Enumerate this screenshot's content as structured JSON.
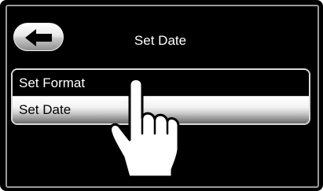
{
  "header": {
    "title": "Set Date",
    "back_icon": "left-arrow-icon"
  },
  "menu": {
    "items": [
      {
        "label": "Set Format",
        "selected": false
      },
      {
        "label": "Set Date",
        "selected": true
      }
    ]
  },
  "overlay": {
    "icon": "tapping-hand-icon"
  },
  "colors": {
    "screen_bg": "#000000",
    "text_light": "#ffffff",
    "selected_bg": "#e6e6e6",
    "frame": "#9a9a9a"
  }
}
